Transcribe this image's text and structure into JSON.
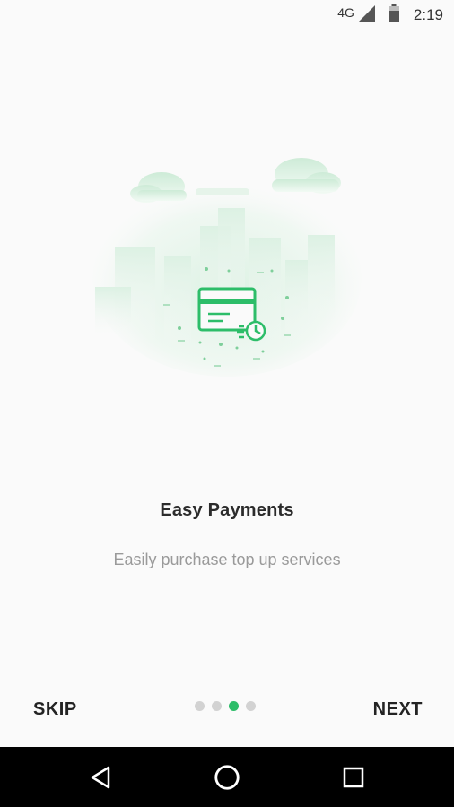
{
  "status_bar": {
    "network": "4G",
    "time": "2:19",
    "icons": [
      "signal-icon",
      "battery-icon"
    ]
  },
  "onboarding": {
    "illustration": "card-payment-illustration",
    "title": "Easy Payments",
    "subtitle": "Easily purchase top up services",
    "page_indicator": {
      "total": 4,
      "active_index": 2
    },
    "skip_label": "SKIP",
    "next_label": "NEXT"
  },
  "colors": {
    "accent": "#2dbd69",
    "background": "#fafafa",
    "nav_bar": "#000000"
  },
  "nav_bar": {
    "icons": [
      "back-icon",
      "home-icon",
      "recent-apps-icon"
    ]
  }
}
